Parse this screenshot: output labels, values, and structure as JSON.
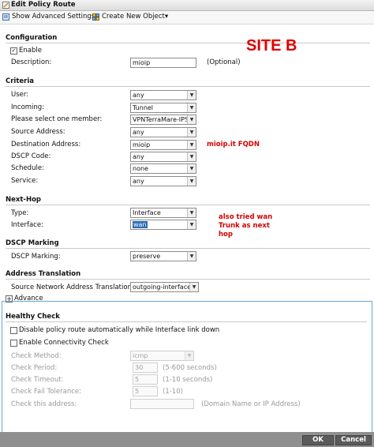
{
  "window": {
    "title": "Edit Policy Route"
  },
  "toolbar": {
    "show_advanced": "Show Advanced Settings",
    "create_new": "Create New Object▾"
  },
  "configuration": {
    "heading": "Configuration",
    "enable_label": "Enable",
    "description_label": "Description:",
    "description_value": "mioip",
    "description_hint": "(Optional)"
  },
  "criteria": {
    "heading": "Criteria",
    "user_label": "User:",
    "user_value": "any",
    "incoming_label": "Incoming:",
    "incoming_value": "Tunnel",
    "member_label": "Please select one member:",
    "member_value": "VPNTerraMare-IPSe",
    "source_label": "Source Address:",
    "source_value": "any",
    "destination_label": "Destination Address:",
    "destination_value": "mioip",
    "dscp_label": "DSCP Code:",
    "dscp_value": "any",
    "schedule_label": "Schedule:",
    "schedule_value": "none",
    "service_label": "Service:",
    "service_value": "any"
  },
  "nexthop": {
    "heading": "Next-Hop",
    "type_label": "Type:",
    "type_value": "Interface",
    "interface_label": "Interface:",
    "interface_value": "wan"
  },
  "dscp_marking": {
    "heading": "DSCP Marking",
    "label": "DSCP Marking:",
    "value": "preserve"
  },
  "address_translation": {
    "heading": "Address Translation",
    "snat_label": "Source Network Address Translation:",
    "snat_value": "outgoing-interface"
  },
  "advance": {
    "label": "Advance"
  },
  "healthy_check": {
    "heading": "Healthy Check",
    "disable_label": "Disable policy route automatically while Interface link down",
    "enable_label": "Enable Connectivity Check",
    "method_label": "Check Method:",
    "method_value": "icmp",
    "period_label": "Check Period:",
    "period_value": "30",
    "period_hint": "(5-600 seconds)",
    "timeout_label": "Check Timeout:",
    "timeout_value": "5",
    "timeout_hint": "(1-10 seconds)",
    "fail_label": "Check Fail Tolerance:",
    "fail_value": "5",
    "fail_hint": "(1-10)",
    "address_label": "Check this address:",
    "address_value": "",
    "address_hint": "(Domain Name or IP Address)"
  },
  "annotations": {
    "site": "SITE B",
    "fqdn": "mioip.it FQDN",
    "wan_note_1": "also tried wan",
    "wan_note_2": "Trunk as next",
    "wan_note_3": "hop"
  },
  "footer": {
    "ok": "OK",
    "cancel": "Cancel"
  }
}
